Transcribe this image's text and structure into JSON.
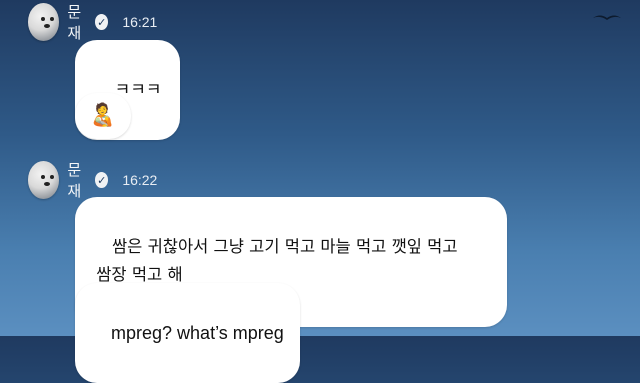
{
  "sender": {
    "name": "문재"
  },
  "messages": [
    {
      "time": "16:21",
      "bubbles": [
        "ㅋㅋㅋ",
        "🧑‍🍼"
      ]
    },
    {
      "time": "16:22",
      "bubbles": [
        "쌈은 귀찮아서 그냥 고기 먹고 마늘 먹고 깻잎 먹고\n 쌈장 먹고 해",
        "mpreg? what’s mpreg"
      ]
    }
  ],
  "icons": {
    "verified": "verified-check-icon",
    "background": "bird-icon"
  },
  "colors": {
    "bubble": "#ffffff",
    "bg_top": "#1f3a60",
    "bg_bottom": "#5b8fc0"
  }
}
